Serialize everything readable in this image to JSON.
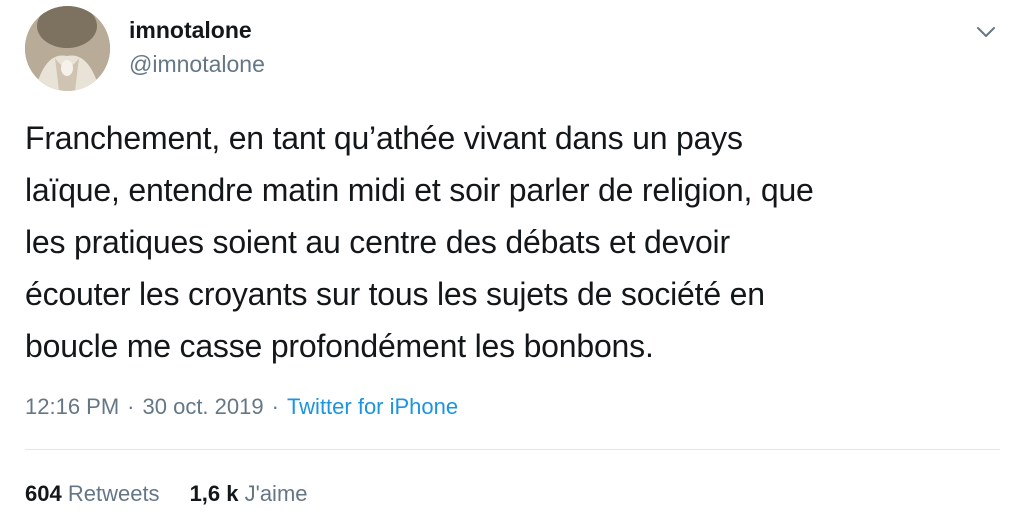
{
  "user": {
    "display_name": "imnotalone",
    "handle": "@imnotalone"
  },
  "tweet": {
    "text": "Franchement, en tant qu’athée vivant dans un pays\nlaïque, entendre matin midi et soir parler de religion, que\nles pratiques soient au centre des débats et devoir\nécouter les croyants sur tous les sujets de société en\nboucle me casse profondément les bonbons.",
    "time": "12:16 PM",
    "separator": "·",
    "date": "30 oct. 2019",
    "source": "Twitter for iPhone"
  },
  "stats": {
    "retweets_count": "604",
    "retweets_label": "Retweets",
    "likes_count": "1,6 k",
    "likes_label": "J'aime"
  },
  "icons": {
    "menu": "chevron-down-icon"
  },
  "colors": {
    "text_primary": "#14171a",
    "text_secondary": "#657786",
    "link": "#1b95e0",
    "divider": "#e1e8ed"
  }
}
